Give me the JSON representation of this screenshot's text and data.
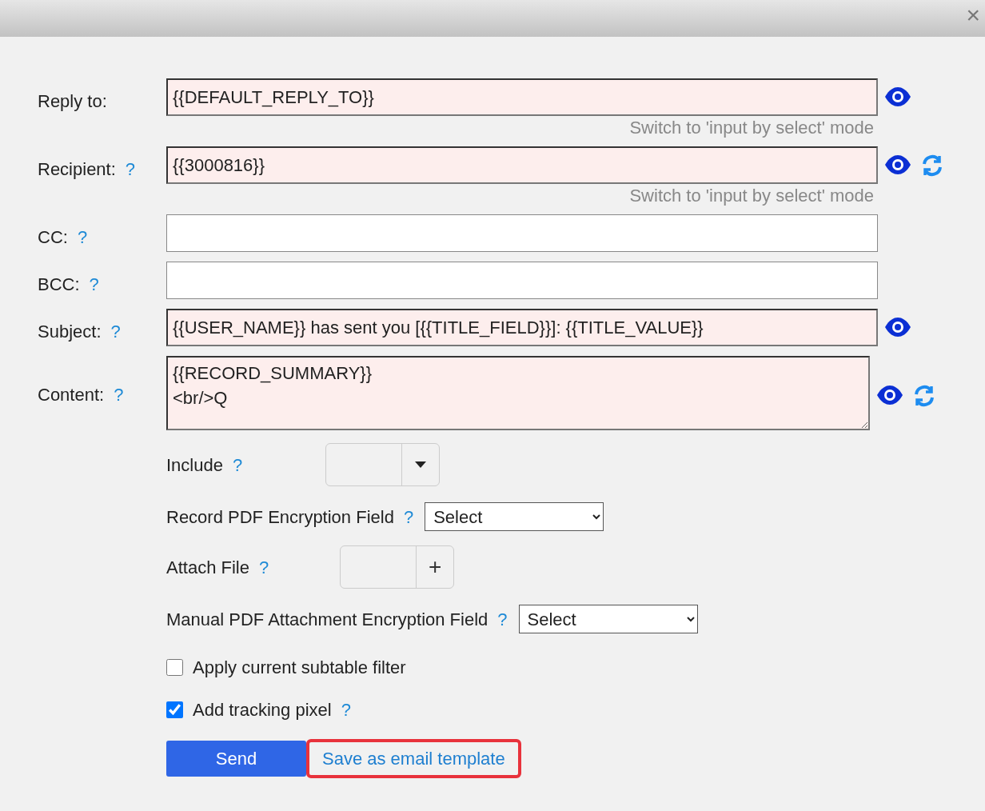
{
  "dialog": {
    "close_symbol": "×"
  },
  "fields": [
    {
      "label": "Reply to:",
      "value": "{{DEFAULT_REPLY_TO}}",
      "kind": "input",
      "highlighted": true,
      "eye": true,
      "refresh": false,
      "switch_text": "Switch to 'input by select' mode"
    },
    {
      "label": "Recipient:",
      "help": "?",
      "value": "{{3000816}}",
      "kind": "input",
      "highlighted": true,
      "eye": true,
      "refresh": true,
      "switch_text": "Switch to 'input by select' mode"
    },
    {
      "label": "CC:",
      "help": "?",
      "kind": "input",
      "highlighted": false,
      "eye": false,
      "refresh": false
    },
    {
      "label": "BCC:",
      "help": "?",
      "kind": "input",
      "highlighted": false,
      "eye": false,
      "refresh": false
    },
    {
      "label": "Subject:",
      "help": "?",
      "value": "{{USER_NAME}} has sent you [{{TITLE_FIELD}}]: {{TITLE_VALUE}}",
      "kind": "input",
      "highlighted": true,
      "eye": true,
      "refresh": false
    },
    {
      "label": "Content:",
      "help": "?",
      "value": "{{RECORD_SUMMARY}}\n<br/>Q",
      "kind": "textarea",
      "highlighted": true,
      "eye": true,
      "refresh": true
    }
  ],
  "options": [
    {
      "kind": "dropdown",
      "label": "Include",
      "help": "?"
    },
    {
      "kind": "select",
      "label": "Record PDF Encryption Field",
      "help": "?",
      "value": "Select"
    },
    {
      "kind": "add",
      "label": "Attach File",
      "help": "?",
      "symbol": "+"
    },
    {
      "kind": "select",
      "label": "Manual PDF Attachment Encryption Field",
      "help": "?",
      "value": "Select"
    }
  ],
  "checkboxes": [
    {
      "label": "Apply current subtable filter",
      "checked": false
    },
    {
      "label": "Add tracking pixel",
      "help": "?",
      "checked": true
    }
  ],
  "send_button": "Send",
  "template_link": {
    "label": "Save as email template",
    "highlighted": true
  }
}
